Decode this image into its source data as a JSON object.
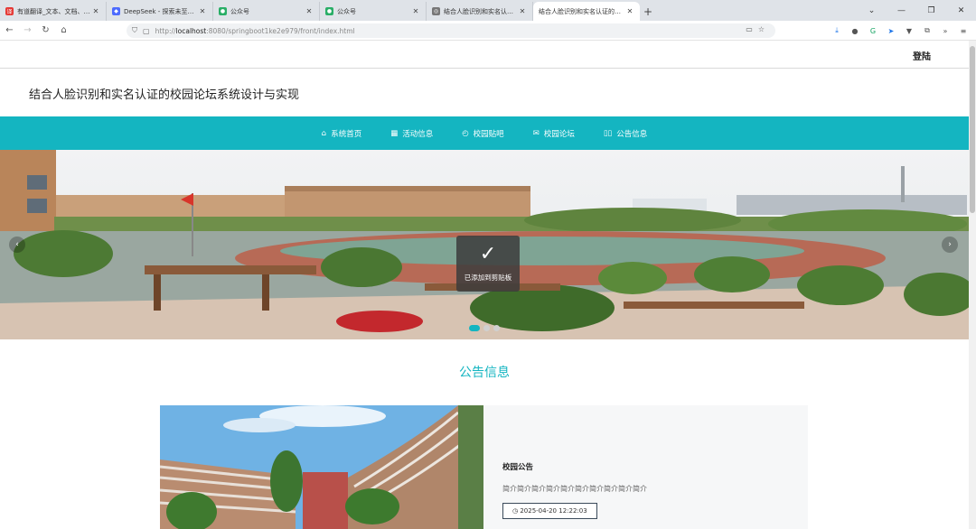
{
  "browser": {
    "tabs": [
      {
        "title": "有道翻译_文本、文档、网页、空",
        "icon_color": "#e53935",
        "icon_glyph": "译"
      },
      {
        "title": "DeepSeek - 探索未至之境",
        "icon_color": "#4d6bfe",
        "icon_glyph": "◆"
      },
      {
        "title": "公众号",
        "icon_color": "#2aae67",
        "icon_glyph": "●"
      },
      {
        "title": "公众号",
        "icon_color": "#2aae67",
        "icon_glyph": "●"
      },
      {
        "title": "结合人脸识别和实名认证的校园",
        "icon_color": "#777777",
        "icon_glyph": "◎"
      },
      {
        "title": "结合人脸识别和实名认证的校园论坛",
        "icon_color": "#ffffff",
        "icon_glyph": ""
      }
    ],
    "active_tab": 5,
    "url_prefix": "http://",
    "url_host": "localhost",
    "url_rest": ":8080/springboot1ke2e979/front/index.html"
  },
  "header": {
    "login_label": "登陆",
    "site_title": "结合人脸识别和实名认证的校园论坛系统设计与实现"
  },
  "nav": {
    "items": [
      {
        "label": "系统首页",
        "icon": "⌂"
      },
      {
        "label": "活动信息",
        "icon": "▦"
      },
      {
        "label": "校园贴吧",
        "icon": "◴"
      },
      {
        "label": "校园论坛",
        "icon": "✉"
      },
      {
        "label": "公告信息",
        "icon": "▯▯"
      }
    ]
  },
  "banner": {
    "toast_message": "已添加到剪贴板",
    "slide_count": 3,
    "active_slide": 0
  },
  "notice": {
    "section_title": "公告信息",
    "card_title": "校园公告",
    "card_text": "简介简介简介简介简介简介简介简介简介简介",
    "card_date": "◷ 2025-04-20 12:22:03"
  },
  "colors": {
    "accent": "#14b5c1"
  }
}
